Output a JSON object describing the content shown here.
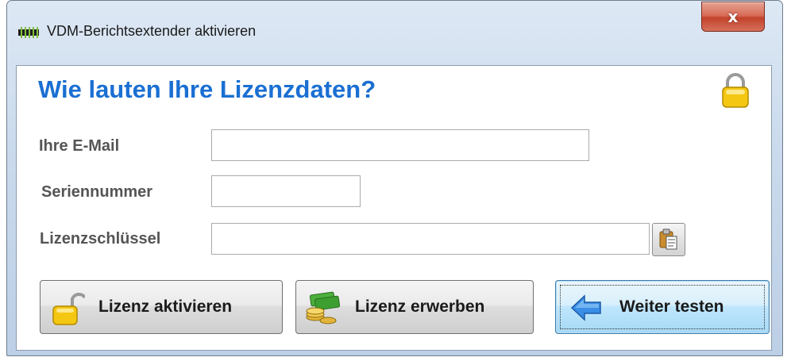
{
  "window": {
    "title": "VDM-Berichtsextender aktivieren",
    "close_glyph": "x"
  },
  "form": {
    "heading": "Wie lauten Ihre Lizenzdaten?",
    "email_label": "Ihre E-Mail",
    "email_value": "",
    "serial_label": "Seriennummer",
    "serial_value": "",
    "license_label": "Lizenzschlüssel",
    "license_value": ""
  },
  "buttons": {
    "activate_label": "Lizenz aktivieren",
    "buy_label": "Lizenz erwerben",
    "continue_label": "Weiter testen"
  },
  "icons": {
    "app": "app-icon",
    "lock": "lock-icon",
    "paste": "clipboard-paste-icon",
    "unlock": "open-lock-icon",
    "money": "money-icon",
    "arrow": "arrow-left-icon"
  },
  "colors": {
    "heading": "#1a6fd2",
    "label": "#555555",
    "close": "#c3432b",
    "default_button": "#bee6fd"
  }
}
